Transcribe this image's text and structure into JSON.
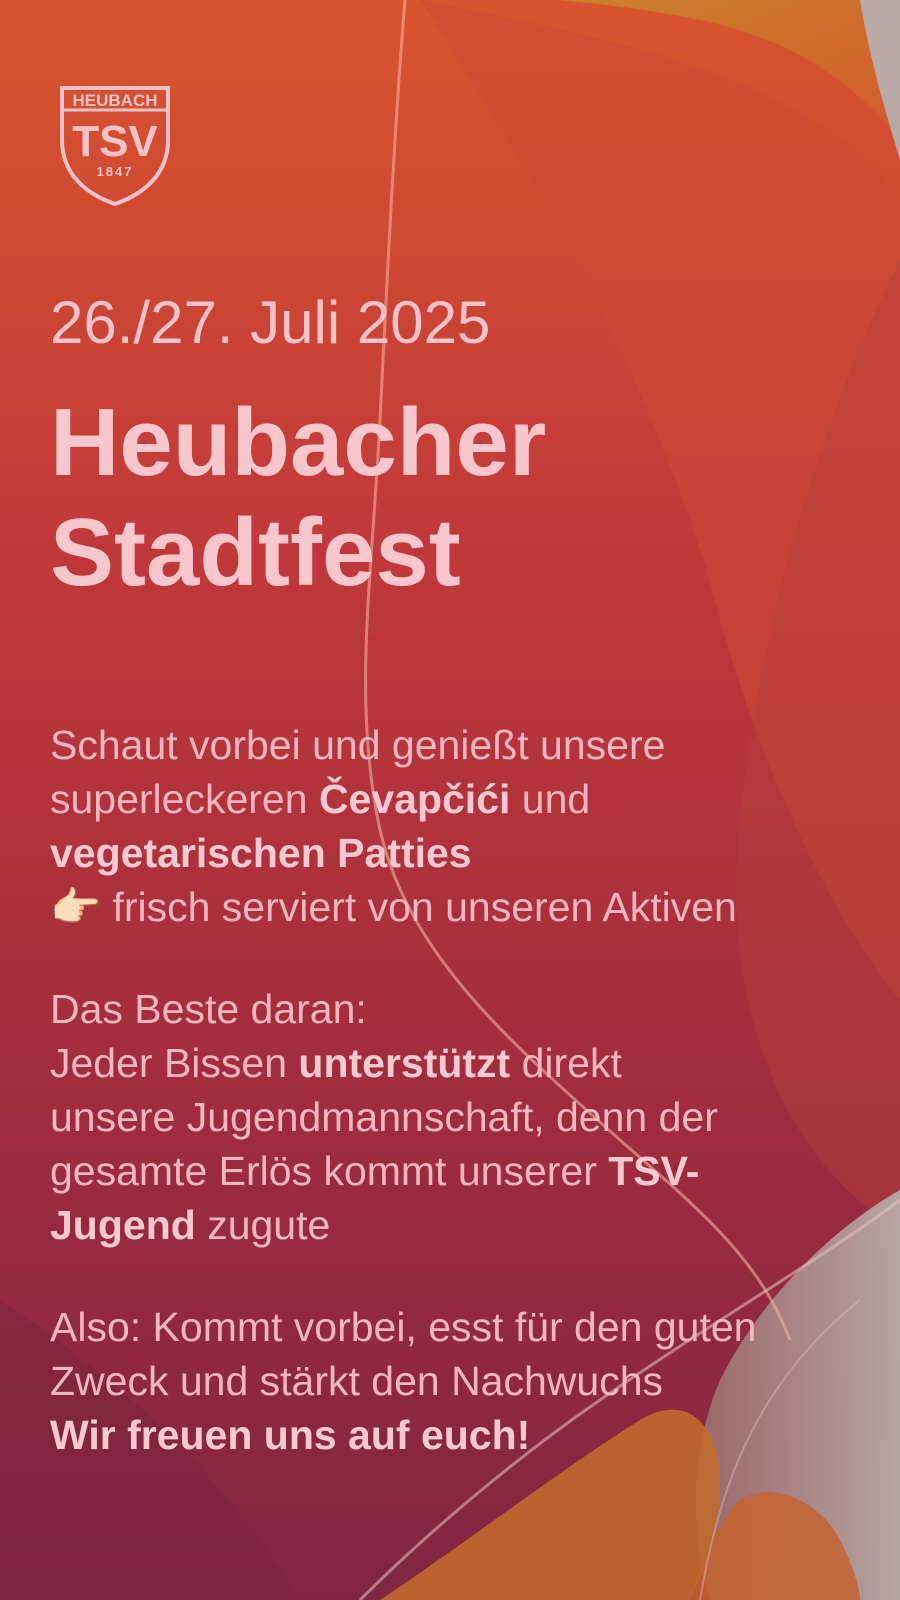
{
  "logo": {
    "top_text": "HEUBACH",
    "letters": "TSV",
    "year": "1847"
  },
  "date": "26./27. Juli 2025",
  "title": {
    "line1": "Heubacher",
    "line2": "Stadtfest"
  },
  "paragraph1": {
    "l1": "Schaut vorbei und genießt unsere",
    "l2_a": "superleckeren ",
    "l2_b": "Čevapčići",
    "l2_c": " und",
    "l3": "vegetarischen Patties",
    "l4_icon": "👉🏻",
    "l4": " frisch serviert von unseren Aktiven"
  },
  "paragraph2": {
    "l1": "Das Beste daran:",
    "l2_a": "Jeder Bissen ",
    "l2_b": "unterstützt",
    "l2_c": " direkt",
    "l3": "unsere Jugendmannschaft, denn der",
    "l4_a": "gesamte Erlös kommt unserer ",
    "l4_b": "TSV-",
    "l5_a": "Jugend",
    "l5_b": " zugute"
  },
  "paragraph3": {
    "l1": "Also: Kommt vorbei, esst für den guten",
    "l2": "Zweck und stärkt den Nachwuchs",
    "l3": "Wir freuen uns auf euch!"
  },
  "colors": {
    "text": "#f6c1c8",
    "bg_top": "#d9552e",
    "bg_bottom": "#8a2a3e",
    "accent_orange": "#d66a2a",
    "grey_shape": "#b9aaa8"
  }
}
